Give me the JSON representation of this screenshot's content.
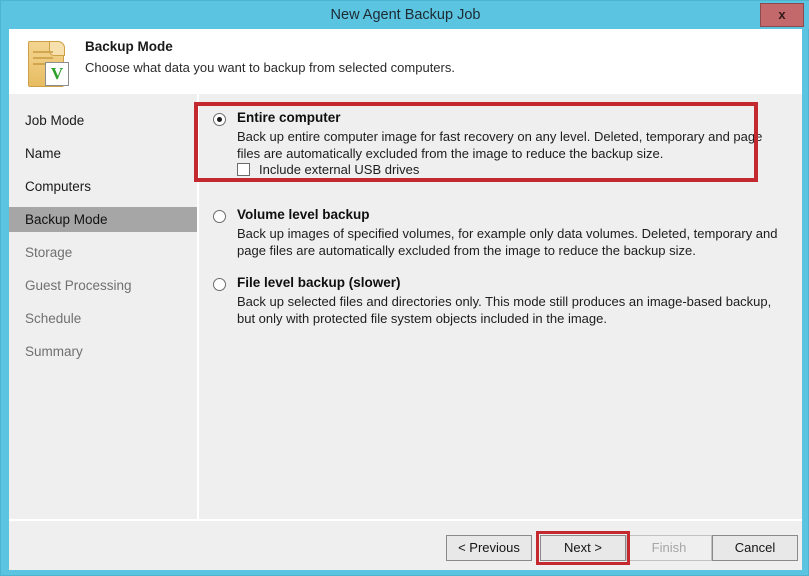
{
  "window": {
    "title": "New Agent Backup Job",
    "close_label": "x",
    "accent_color": "#5bc4e0",
    "highlight_color": "#c4292f"
  },
  "header": {
    "icon": "scroll-document-icon",
    "badge_letter": "V",
    "title": "Backup Mode",
    "subtitle": "Choose what data you want to backup from selected computers."
  },
  "sidebar": {
    "items": [
      {
        "label": "Job Mode",
        "state": "visited"
      },
      {
        "label": "Name",
        "state": "visited"
      },
      {
        "label": "Computers",
        "state": "visited"
      },
      {
        "label": "Backup Mode",
        "state": "active"
      },
      {
        "label": "Storage",
        "state": "upcoming"
      },
      {
        "label": "Guest Processing",
        "state": "upcoming"
      },
      {
        "label": "Schedule",
        "state": "upcoming"
      },
      {
        "label": "Summary",
        "state": "upcoming"
      }
    ]
  },
  "main": {
    "options": [
      {
        "title": "Entire computer",
        "description": "Back up entire computer image for fast recovery on any level. Deleted, temporary and page files are automatically excluded from the image to reduce the backup size.",
        "selected": true,
        "sub_checkbox": {
          "label": "Include external USB drives",
          "checked": false
        }
      },
      {
        "title": "Volume level backup",
        "description": "Back up images of specified volumes, for example only data volumes. Deleted, temporary and page files are automatically excluded from the image to reduce the backup size.",
        "selected": false
      },
      {
        "title": "File level backup (slower)",
        "description": "Back up selected files and directories only. This mode still produces an image-based backup, but only with protected file system objects included in the image.",
        "selected": false
      }
    ]
  },
  "footer": {
    "previous_label": "< Previous",
    "next_label": "Next >",
    "finish_label": "Finish",
    "cancel_label": "Cancel"
  }
}
